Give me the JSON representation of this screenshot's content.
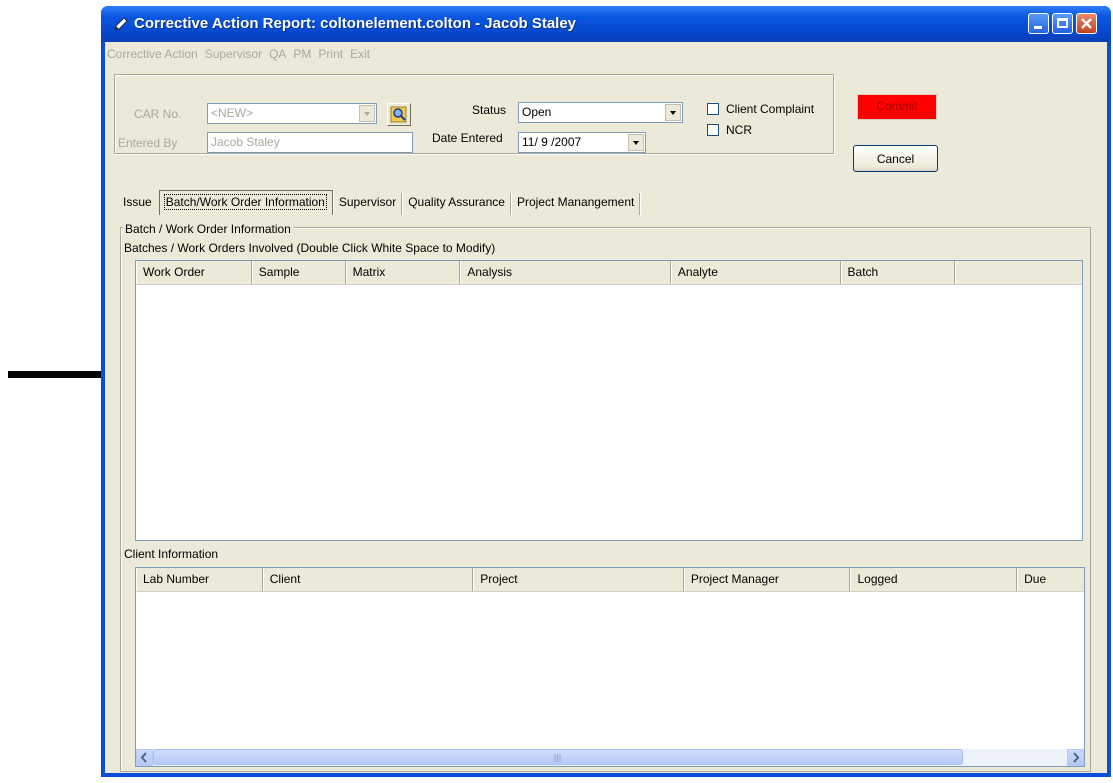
{
  "window": {
    "title": "Corrective Action Report: coltonelement.colton - Jacob Staley"
  },
  "menu": [
    "Corrective Action",
    "Supervisor",
    "QA",
    "PM",
    "Print",
    "Exit"
  ],
  "header": {
    "car_no_label": "CAR No.",
    "car_no_value": "<NEW>",
    "entered_by_label": "Entered By",
    "entered_by_value": "Jacob Staley",
    "status_label": "Status",
    "status_value": "Open",
    "date_entered_label": "Date Entered",
    "date_entered_value": "11/ 9 /2007",
    "client_complaint_label": "Client Complaint",
    "client_complaint_checked": false,
    "ncr_label": "NCR",
    "ncr_checked": false,
    "commit_label": "Commit",
    "cancel_label": "Cancel"
  },
  "tabs": [
    {
      "label": "Issue",
      "active": false
    },
    {
      "label": "Batch/Work Order Information",
      "active": true
    },
    {
      "label": "Supervisor",
      "active": false
    },
    {
      "label": "Quality Assurance",
      "active": false
    },
    {
      "label": "Project Manangement",
      "active": false
    }
  ],
  "batch_section": {
    "group_title": "Batch / Work Order Information",
    "list_caption": "Batches / Work Orders Involved  (Double Click White Space to Modify)",
    "columns": [
      "Work Order",
      "Sample",
      "Matrix",
      "Analysis",
      "Analyte",
      "Batch"
    ],
    "rows": []
  },
  "client_section": {
    "caption": "Client Information",
    "columns": [
      "Lab Number",
      "Client",
      "Project",
      "Project Manager",
      "Logged",
      "Due"
    ],
    "rows": []
  },
  "colors": {
    "titlebar": "#0a57e0",
    "commit_button": "#ff0000",
    "dialog_bg": "#ece9d8"
  }
}
